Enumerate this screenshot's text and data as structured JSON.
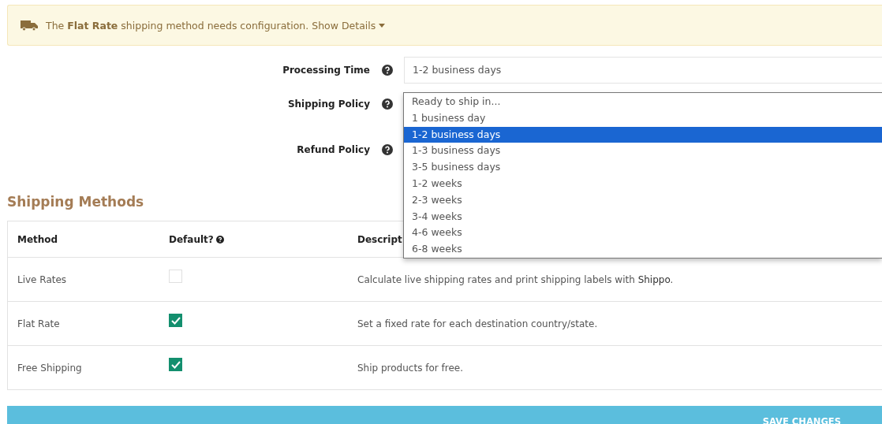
{
  "alert": {
    "before": "The ",
    "bold": "Flat Rate",
    "after": " shipping method needs configuration.",
    "link": "Show Details"
  },
  "settings": [
    {
      "label": "Processing Time"
    },
    {
      "label": "Shipping Policy"
    },
    {
      "label": "Refund Policy"
    }
  ],
  "processing_select": {
    "value": "1-2 business days",
    "options": [
      {
        "label": "Ready to ship in...",
        "selected": false
      },
      {
        "label": "1 business day",
        "selected": false
      },
      {
        "label": "1-2 business days",
        "selected": true
      },
      {
        "label": "1-3 business days",
        "selected": false
      },
      {
        "label": "3-5 business days",
        "selected": false
      },
      {
        "label": "1-2 weeks",
        "selected": false
      },
      {
        "label": "2-3 weeks",
        "selected": false
      },
      {
        "label": "3-4 weeks",
        "selected": false
      },
      {
        "label": "4-6 weeks",
        "selected": false
      },
      {
        "label": "6-8 weeks",
        "selected": false
      }
    ]
  },
  "section_title": "Shipping Methods",
  "table": {
    "columns": [
      "Method",
      "Default?",
      "Descript"
    ],
    "rows": [
      {
        "method": "Live Rates",
        "checked": false,
        "description": "Calculate live shipping rates and print shipping labels with ",
        "link": "Shippo",
        "after": "."
      },
      {
        "method": "Flat Rate",
        "checked": true,
        "description": "Set a fixed rate for each destination country/state."
      },
      {
        "method": "Free Shipping",
        "checked": true,
        "description": "Ship products for free."
      }
    ]
  },
  "save_button": "SAVE CHANGES"
}
